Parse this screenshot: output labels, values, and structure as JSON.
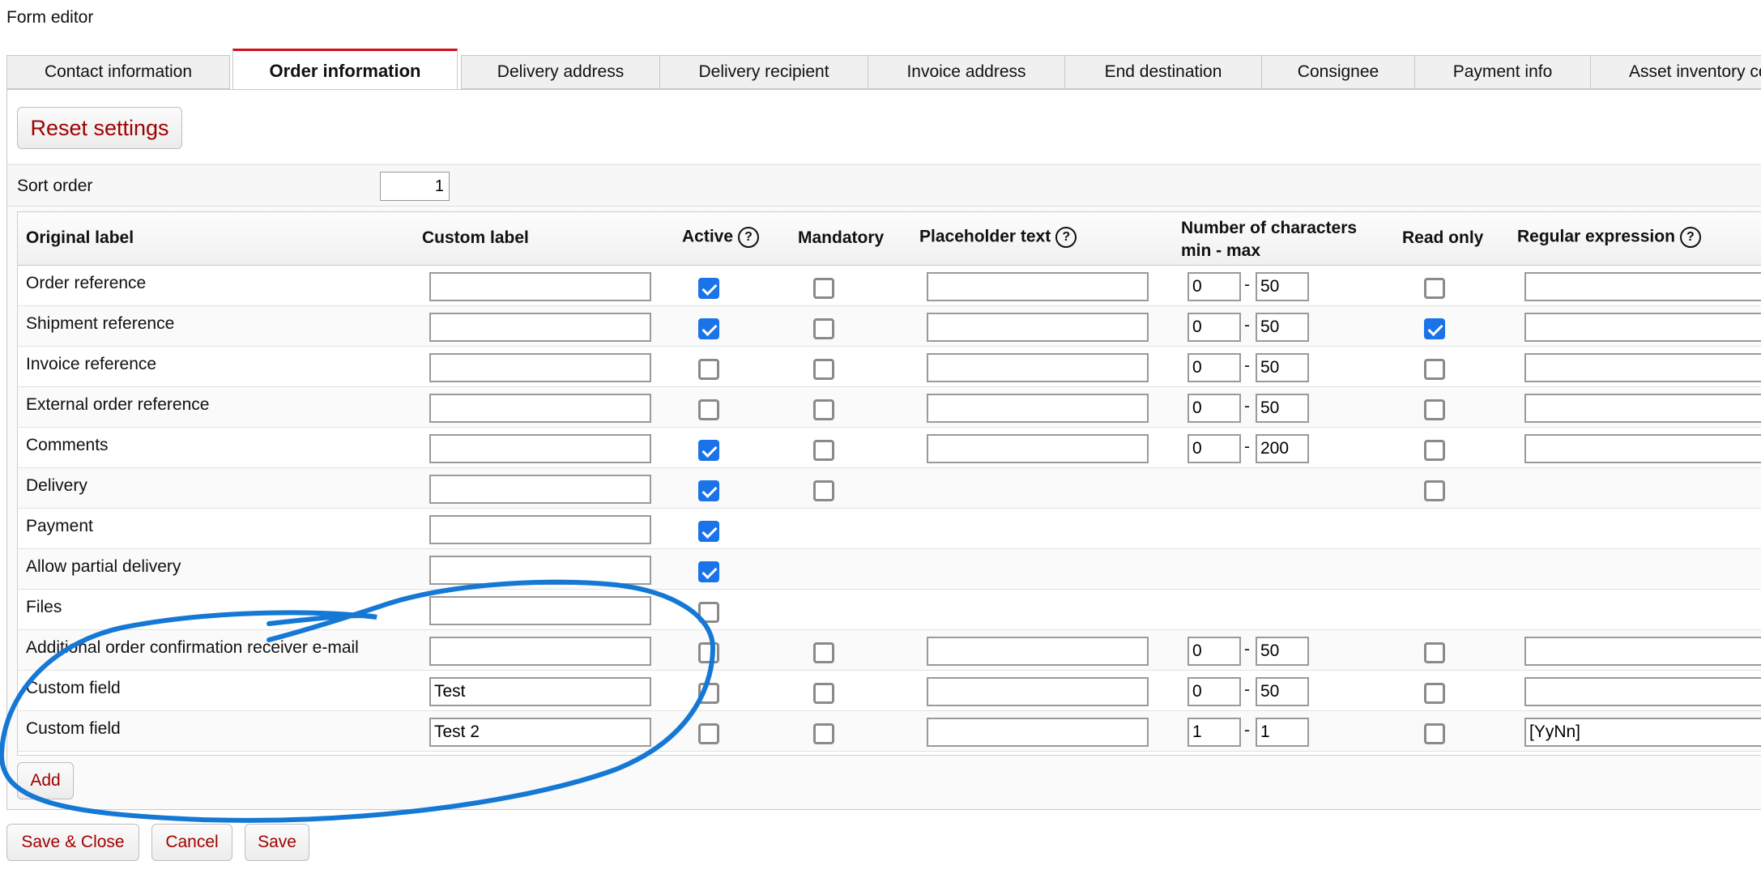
{
  "window_title": "Form editor",
  "tabs": [
    {
      "label": "Contact information",
      "active": false
    },
    {
      "label": "Order information",
      "active": true
    },
    {
      "label": "Delivery address",
      "active": false
    },
    {
      "label": "Delivery recipient",
      "active": false
    },
    {
      "label": "Invoice address",
      "active": false
    },
    {
      "label": "End destination",
      "active": false
    },
    {
      "label": "Consignee",
      "active": false
    },
    {
      "label": "Payment info",
      "active": false
    },
    {
      "label": "Asset inventory co",
      "active": false
    }
  ],
  "reset_button": "Reset settings",
  "sort_order": {
    "label": "Sort order",
    "value": "1"
  },
  "columns": {
    "original_label": "Original label",
    "custom_label": "Custom label",
    "active": "Active",
    "mandatory": "Mandatory",
    "placeholder_text": "Placeholder text",
    "num_chars_line1": "Number of characters",
    "num_chars_line2": "min - max",
    "read_only": "Read only",
    "regex": "Regular expression",
    "help_glyph": "?"
  },
  "range_separator": "-",
  "rows": [
    {
      "label": "Order reference",
      "custom": "",
      "active": true,
      "mandatory": false,
      "has_placeholder": true,
      "placeholder": "",
      "has_range": true,
      "min": "0",
      "max": "50",
      "has_readonly": true,
      "readonly": false,
      "has_regex": true,
      "regex": ""
    },
    {
      "label": "Shipment reference",
      "custom": "",
      "active": true,
      "mandatory": false,
      "has_placeholder": true,
      "placeholder": "",
      "has_range": true,
      "min": "0",
      "max": "50",
      "has_readonly": true,
      "readonly": true,
      "has_regex": true,
      "regex": ""
    },
    {
      "label": "Invoice reference",
      "custom": "",
      "active": false,
      "mandatory": false,
      "has_placeholder": true,
      "placeholder": "",
      "has_range": true,
      "min": "0",
      "max": "50",
      "has_readonly": true,
      "readonly": false,
      "has_regex": true,
      "regex": ""
    },
    {
      "label": "External order reference",
      "custom": "",
      "active": false,
      "mandatory": false,
      "has_placeholder": true,
      "placeholder": "",
      "has_range": true,
      "min": "0",
      "max": "50",
      "has_readonly": true,
      "readonly": false,
      "has_regex": true,
      "regex": ""
    },
    {
      "label": "Comments",
      "custom": "",
      "active": true,
      "mandatory": false,
      "has_placeholder": true,
      "placeholder": "",
      "has_range": true,
      "min": "0",
      "max": "200",
      "has_readonly": true,
      "readonly": false,
      "has_regex": true,
      "regex": ""
    },
    {
      "label": "Delivery",
      "custom": "",
      "active": true,
      "has_mandatory": true,
      "mandatory": false,
      "has_placeholder": false,
      "has_range": false,
      "has_readonly": true,
      "readonly": false,
      "has_regex": false
    },
    {
      "label": "Payment",
      "custom": "",
      "active": true,
      "has_mandatory": false,
      "has_placeholder": false,
      "has_range": false,
      "has_readonly": false,
      "has_regex": false
    },
    {
      "label": "Allow partial delivery",
      "custom": "",
      "active": true,
      "has_mandatory": false,
      "has_placeholder": false,
      "has_range": false,
      "has_readonly": false,
      "has_regex": false
    },
    {
      "label": "Files",
      "custom": "",
      "active": false,
      "has_mandatory": false,
      "has_placeholder": false,
      "has_range": false,
      "has_readonly": false,
      "has_regex": false
    },
    {
      "label": "Additional order confirmation receiver e-mail",
      "custom": "",
      "active": false,
      "mandatory": false,
      "has_placeholder": true,
      "placeholder": "",
      "has_range": true,
      "min": "0",
      "max": "50",
      "has_readonly": true,
      "readonly": false,
      "has_regex": true,
      "regex": ""
    },
    {
      "label": "Custom field",
      "custom": "Test",
      "active": false,
      "mandatory": false,
      "has_placeholder": true,
      "placeholder": "",
      "has_range": true,
      "min": "0",
      "max": "50",
      "has_readonly": true,
      "readonly": false,
      "has_regex": true,
      "regex": ""
    },
    {
      "label": "Custom field",
      "custom": "Test 2",
      "active": false,
      "mandatory": false,
      "has_placeholder": true,
      "placeholder": "",
      "has_range": true,
      "min": "1",
      "max": "1",
      "has_readonly": true,
      "readonly": false,
      "has_regex": true,
      "regex": "[YyNn]"
    }
  ],
  "add_button": "Add",
  "footer": {
    "save_close": "Save & Close",
    "cancel": "Cancel",
    "save": "Save"
  },
  "colors": {
    "accent_red": "#d20f1e",
    "button_text": "#a00000",
    "checkbox_blue": "#1a73e8",
    "annotation_blue": "#1478d4"
  }
}
